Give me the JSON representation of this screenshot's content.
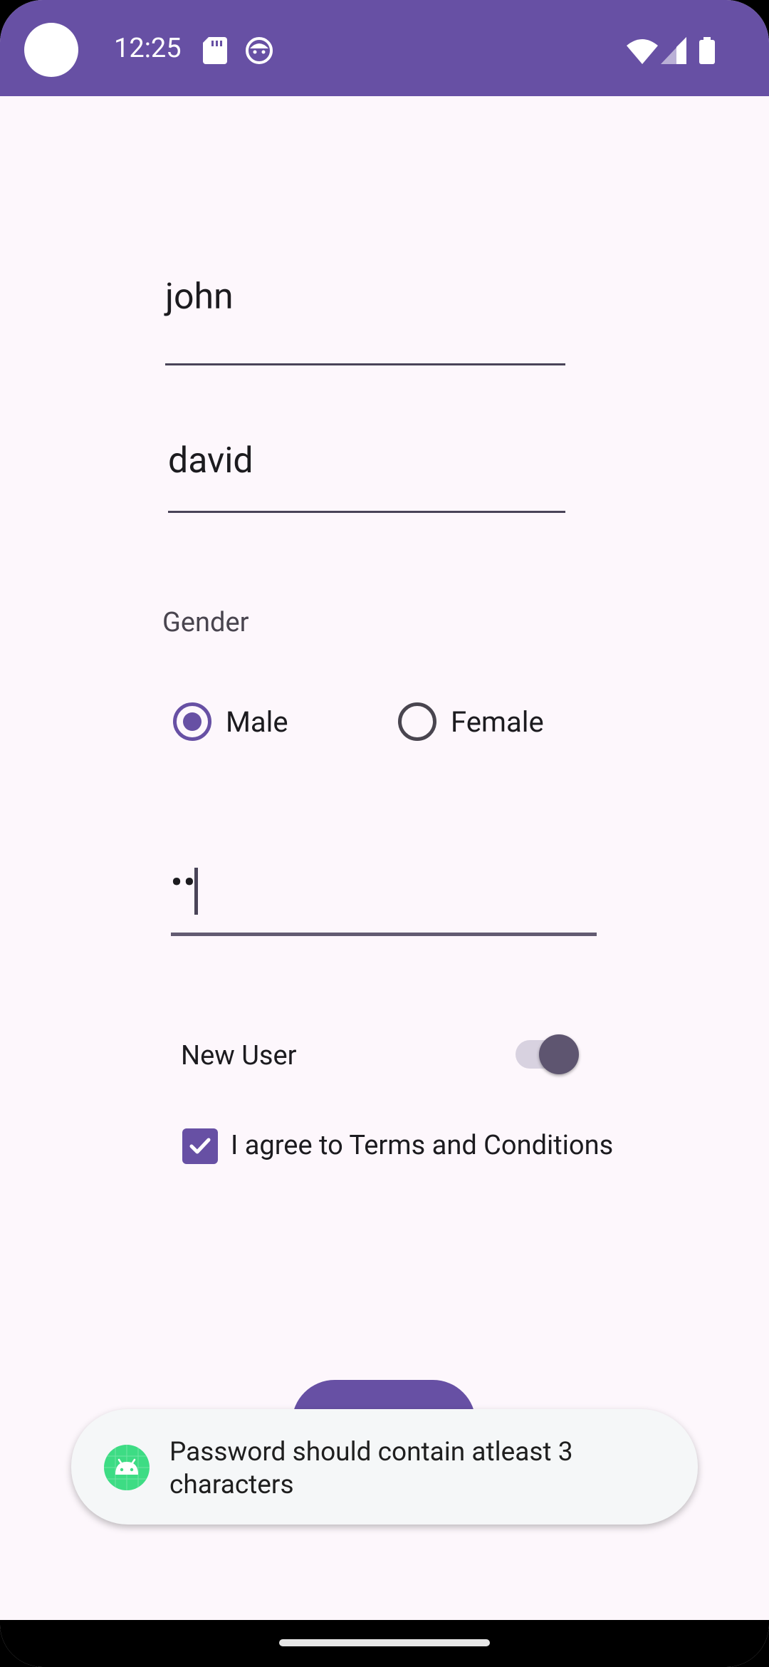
{
  "status_bar": {
    "time": "12:25",
    "icons": [
      "sd-card-icon",
      "face-icon",
      "wifi-icon",
      "signal-icon",
      "battery-icon"
    ]
  },
  "form": {
    "first_name_value": "john",
    "last_name_value": "david",
    "gender_label": "Gender",
    "gender_options": [
      {
        "label": "Male",
        "checked": true
      },
      {
        "label": "Female",
        "checked": false
      }
    ],
    "password_value": "••",
    "new_user_label": "New User",
    "new_user_on": true,
    "terms_label": "I agree to Terms and Conditions",
    "terms_checked": true
  },
  "toast": {
    "message": "Password should contain atleast 3 characters"
  },
  "colors": {
    "primary": "#6750a4",
    "background": "#fdf7fc",
    "toast_bg": "#f5f7f8",
    "android_green": "#3ddc84"
  }
}
